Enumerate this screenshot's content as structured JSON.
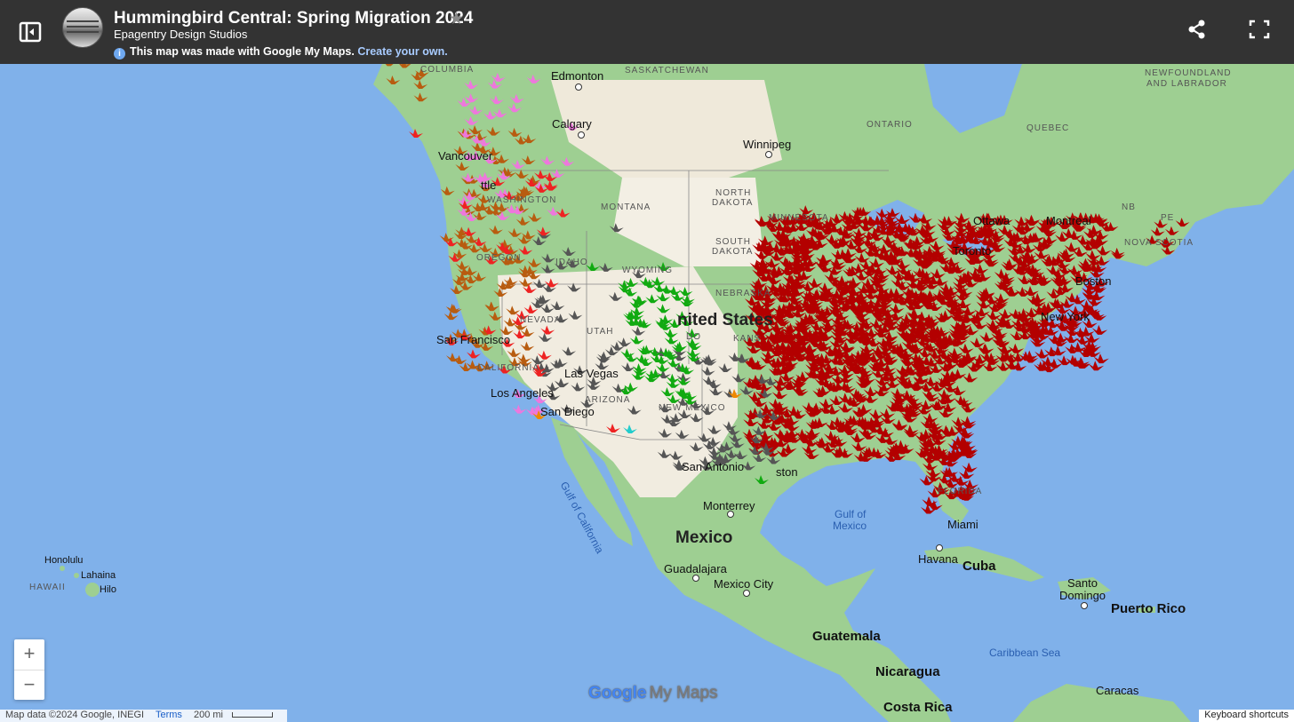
{
  "header": {
    "title": "Hummingbird Central: Spring Migration 2024",
    "author": "Epagentry Design Studios",
    "notice": "This map was made with Google My Maps.",
    "notice_link": "Create your own."
  },
  "map_labels": {
    "columbia": "COLUMBIA",
    "edmonton": "Edmonton",
    "saskatchewan": "SASKATCHEWAN",
    "newfoundland_1": "NEWFOUNDLAND",
    "newfoundland_2": "AND LABRADOR",
    "calgary": "Calgary",
    "ontario": "ONTARIO",
    "quebec": "QUEBEC",
    "winnipeg": "Winnipeg",
    "vancouver": "Vancouver",
    "seattle": "ttle",
    "washington": "WASHINGTON",
    "montana": "MONTANA",
    "north_dakota_1": "NORTH",
    "north_dakota_2": "DAKOTA",
    "minnesota": "MINNESOTA",
    "ottawa": "Ottawa",
    "montreal": "Montreal",
    "nb": "NB",
    "pe": "PE",
    "nova_scotia": "NOVA SCOTIA",
    "south_dakota_1": "SOUTH",
    "south_dakota_2": "DAKOTA",
    "oregon": "OREGON",
    "idaho": "IDAHO",
    "wyoming": "WYOMING",
    "toronto": "Toronto",
    "boston": "Boston",
    "nebraska": "NEBRASKA",
    "united_states": "nited States",
    "new_york": "New York",
    "nevada": "NEVADA",
    "utah": "UTAH",
    "colorado": "DO",
    "kansas": "KANS",
    "san_francisco": "San Francisco",
    "california": "CALIFORNIA",
    "las_vegas": "Las Vegas",
    "los_angeles": "Los Angeles",
    "arizona": "ARIZONA",
    "new_mexico": "NEW MEXICO",
    "san_diego": "San Diego",
    "san_antonio": "San Antonio",
    "houston": "ston",
    "gulf_of_california": "Gulf of California",
    "monterrey": "Monterrey",
    "gulf_of_mexico_1": "Gulf of",
    "gulf_of_mexico_2": "Mexico",
    "florida": "FLORIDA",
    "miami": "Miami",
    "mexico": "Mexico",
    "havana": "Havana",
    "cuba": "Cuba",
    "guadalajara": "Guadalajara",
    "mexico_city": "Mexico City",
    "santo_domingo_1": "Santo",
    "santo_domingo_2": "Domingo",
    "puerto_rico": "Puerto Rico",
    "honolulu": "Honolulu",
    "lahaina": "Lahaina",
    "hawaii": "HAWAII",
    "hilo": "Hilo",
    "guatemala": "Guatemala",
    "caribbean_sea": "Caribbean Sea",
    "nicaragua": "Nicaragua",
    "caracas": "Caracas",
    "costa_rica": "Costa Rica"
  },
  "layer_colors": {
    "ruby_throated": "#b30000",
    "rufous": "#b85c10",
    "calliope": "#ee77dd",
    "black_chinned": "#555555",
    "broad_tailed": "#11aa11",
    "annas": "#ee2222",
    "costas": "#ee8800",
    "other": "#22cccc"
  },
  "controls": {
    "zoom_in": "+",
    "zoom_out": "−"
  },
  "footer": {
    "map_data": "Map data ©2024 Google, INEGI",
    "terms": "Terms",
    "scale": "200 mi",
    "keyboard_shortcuts": "Keyboard shortcuts",
    "logo_google": "Google",
    "logo_mymaps": "My Maps"
  }
}
